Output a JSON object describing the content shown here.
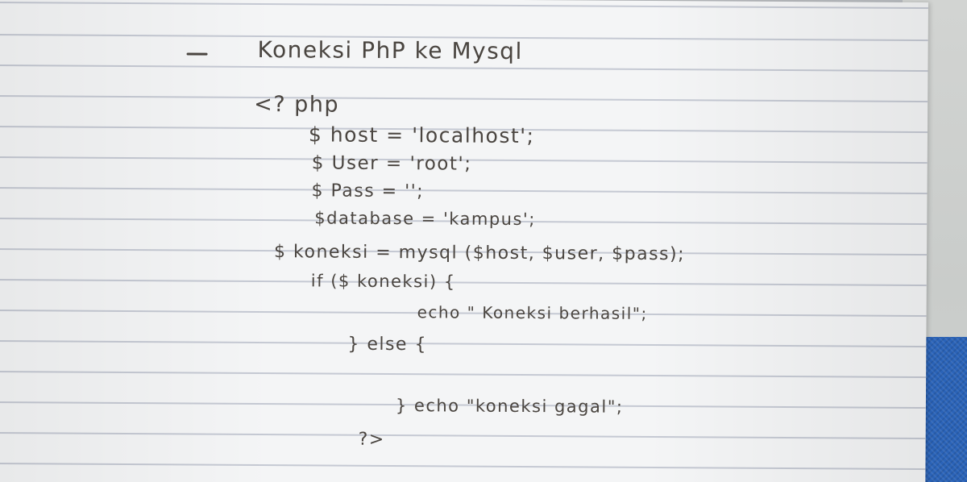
{
  "notebook": {
    "title": "Koneksi PhP ke Mysql",
    "code_lines": [
      "<? php",
      "$ host = 'localhost';",
      "$ User = 'root';",
      "$ Pass = '';",
      "$database = 'kampus';",
      "$ koneksi = mysql ($host, $user, $pass);",
      "if ($ koneksi) {",
      "echo \" Koneksi berhasil\";",
      "} else {",
      "} echo \"koneksi gagal\";",
      "?>"
    ]
  }
}
